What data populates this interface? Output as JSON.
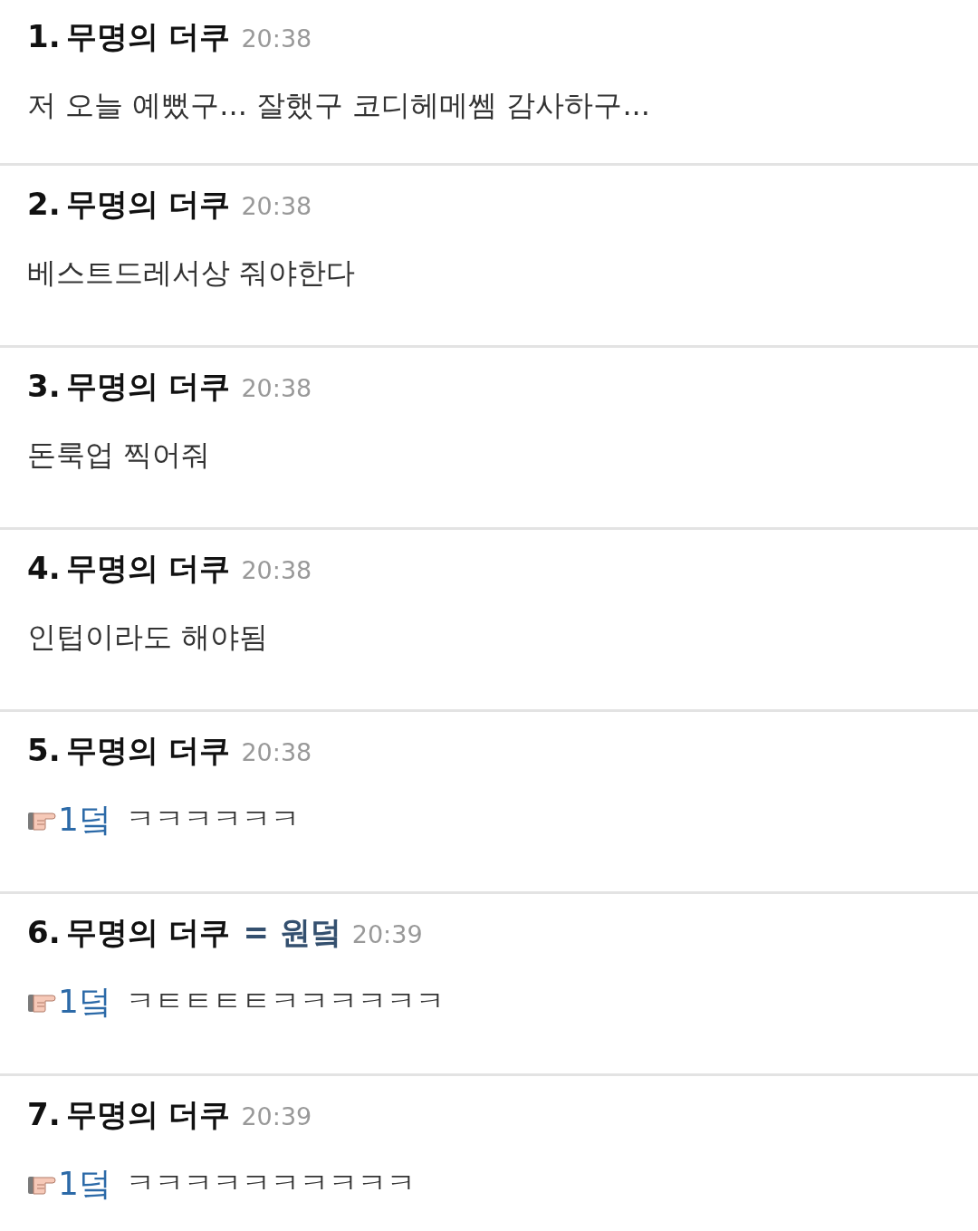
{
  "comments": [
    {
      "number": "1.",
      "author": "무명의 더쿠",
      "time": "20:38",
      "text": "저 오늘 예뻤구... 잘했구 코디헤메쎔 감사하구..."
    },
    {
      "number": "2.",
      "author": "무명의 더쿠",
      "time": "20:38",
      "text": "베스트드레서상 줘야한다"
    },
    {
      "number": "3.",
      "author": "무명의 더쿠",
      "time": "20:38",
      "text": "돈룩업 찍어줘"
    },
    {
      "number": "4.",
      "author": "무명의 더쿠",
      "time": "20:38",
      "text": "인텁이라도 해야됨"
    },
    {
      "number": "5.",
      "author": "무명의 더쿠",
      "time": "20:38",
      "reply_to": "1덬",
      "text": "ㅋㅋㅋㅋㅋㅋ"
    },
    {
      "number": "6.",
      "author": "무명의 더쿠",
      "author_tag": "= 원덬",
      "time": "20:39",
      "reply_to": "1덬",
      "text": "ㅋㅌㅌㅌㅌㅋㅋㅋㅋㅋㅋ"
    },
    {
      "number": "7.",
      "author": "무명의 더쿠",
      "time": "20:39",
      "reply_to": "1덬",
      "text": "ㅋㅋㅋㅋㅋㅋㅋㅋㅋㅋ"
    }
  ]
}
